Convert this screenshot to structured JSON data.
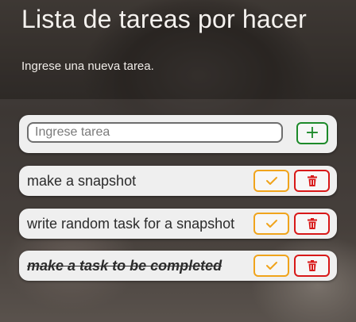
{
  "header": {
    "title": "Lista de tareas por hacer",
    "subtitle": "Ingrese una nueva tarea."
  },
  "form": {
    "placeholder": "Ingrese tarea",
    "add_label": "+"
  },
  "tasks": [
    {
      "text": "make a snapshot",
      "completed": false
    },
    {
      "text": "write random task for a snapshot",
      "completed": false
    },
    {
      "text": "make a task to be completed",
      "completed": true
    }
  ],
  "colors": {
    "add": "#1d8a2a",
    "complete": "#f0a41c",
    "delete": "#d81818"
  },
  "icons": {
    "complete": "check-icon",
    "delete": "trash-icon"
  }
}
